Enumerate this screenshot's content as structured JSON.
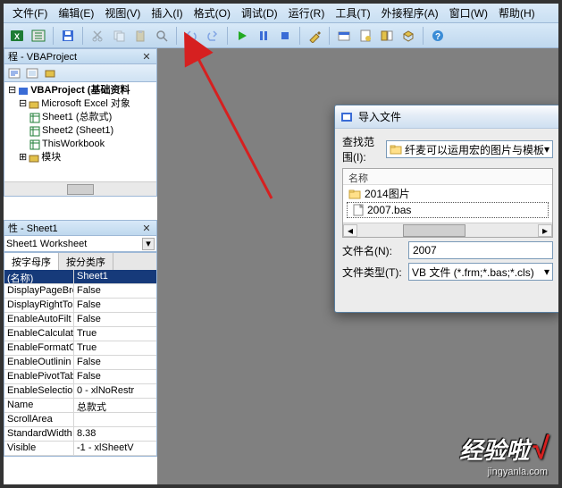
{
  "menu": {
    "items": [
      "文件(F)",
      "编辑(E)",
      "视图(V)",
      "插入(I)",
      "格式(O)",
      "调试(D)",
      "运行(R)",
      "工具(T)",
      "外接程序(A)",
      "窗口(W)",
      "帮助(H)"
    ]
  },
  "toolbar_icons": [
    "excel-icon",
    "save-icon",
    "cut-icon",
    "copy-icon",
    "paste-icon",
    "find-icon",
    "undo-icon",
    "redo-icon",
    "run-icon",
    "pause-icon",
    "stop-icon",
    "design-icon",
    "project-icon",
    "properties-icon",
    "object-browser-icon",
    "toolbox-icon",
    "help-icon"
  ],
  "project_panel": {
    "title": "程 - VBAProject",
    "root": "VBAProject (基础资料",
    "nodes": [
      {
        "label": "Microsoft Excel 对象",
        "icon": "folder-icon"
      },
      {
        "label": "Sheet1 (总款式)",
        "icon": "sheet-icon"
      },
      {
        "label": "Sheet2 (Sheet1)",
        "icon": "sheet-icon"
      },
      {
        "label": "ThisWorkbook",
        "icon": "workbook-icon"
      },
      {
        "label": "模块",
        "icon": "folder-icon"
      }
    ]
  },
  "properties_panel": {
    "title": "性 - Sheet1",
    "object_label": "Sheet1 Worksheet",
    "tabs": [
      "按字母序",
      "按分类序"
    ],
    "rows": [
      {
        "name": "(名称)",
        "value": "Sheet1",
        "header": true
      },
      {
        "name": "DisplayPageBre",
        "value": "False"
      },
      {
        "name": "DisplayRightTo",
        "value": "False"
      },
      {
        "name": "EnableAutoFilt",
        "value": "False"
      },
      {
        "name": "EnableCalculat",
        "value": "True"
      },
      {
        "name": "EnableFormatCo",
        "value": "True"
      },
      {
        "name": "EnableOutlinin",
        "value": "False"
      },
      {
        "name": "EnablePivotTab",
        "value": "False"
      },
      {
        "name": "EnableSelectio",
        "value": "0 - xlNoRestr"
      },
      {
        "name": "Name",
        "value": "总款式"
      },
      {
        "name": "ScrollArea",
        "value": ""
      },
      {
        "name": "StandardWidth",
        "value": "8.38"
      },
      {
        "name": "Visible",
        "value": "-1 - xlSheetV"
      }
    ]
  },
  "dialog": {
    "title": "导入文件",
    "scope_label": "查找范围(I):",
    "scope_value": "纤麦可以运用宏的图片与模板",
    "list_header": "名称",
    "files": [
      {
        "name": "2014图片",
        "icon": "folder-small-icon"
      },
      {
        "name": "2007.bas",
        "icon": "file-icon",
        "selected": true
      }
    ],
    "filename_label": "文件名(N):",
    "filename_value": "2007",
    "filetype_label": "文件类型(T):",
    "filetype_value": "VB 文件 (*.frm;*.bas;*.cls)"
  },
  "watermark": {
    "main": "经验啦",
    "sub": "jingyanla.com",
    "check": "√"
  }
}
